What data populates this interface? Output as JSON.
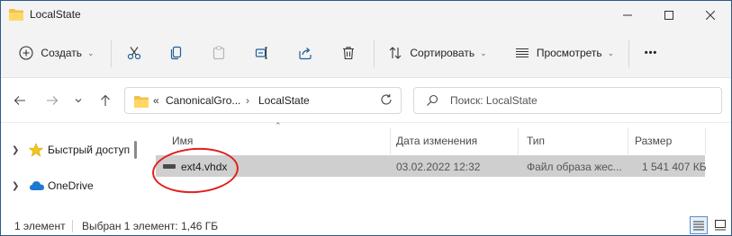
{
  "window": {
    "title": "LocalState"
  },
  "commandbar": {
    "create_label": "Создать",
    "sort_label": "Сортировать",
    "view_label": "Просмотреть",
    "more_label": "•••"
  },
  "address": {
    "overflow": "«",
    "segments": [
      "CanonicalGro...",
      "LocalState"
    ],
    "separator": "›"
  },
  "search": {
    "placeholder": "Поиск: LocalState"
  },
  "navpane": {
    "items": [
      {
        "label": "Быстрый доступ",
        "icon": "star-icon"
      },
      {
        "label": "OneDrive",
        "icon": "cloud-icon"
      }
    ]
  },
  "columns": {
    "name": "Имя",
    "modified": "Дата изменения",
    "type": "Тип",
    "size": "Размер"
  },
  "files": [
    {
      "name": "ext4.vhdx",
      "modified": "03.02.2022 12:32",
      "type": "Файл образа жес...",
      "size": "1 541 407 КБ",
      "selected": true
    }
  ],
  "status": {
    "count": "1 элемент",
    "selection": "Выбран 1 элемент: 1,46 ГБ"
  },
  "colors": {
    "accent": "#0067c0",
    "highlight_circle": "#e0201f",
    "selected_row": "#cfcfcf"
  }
}
